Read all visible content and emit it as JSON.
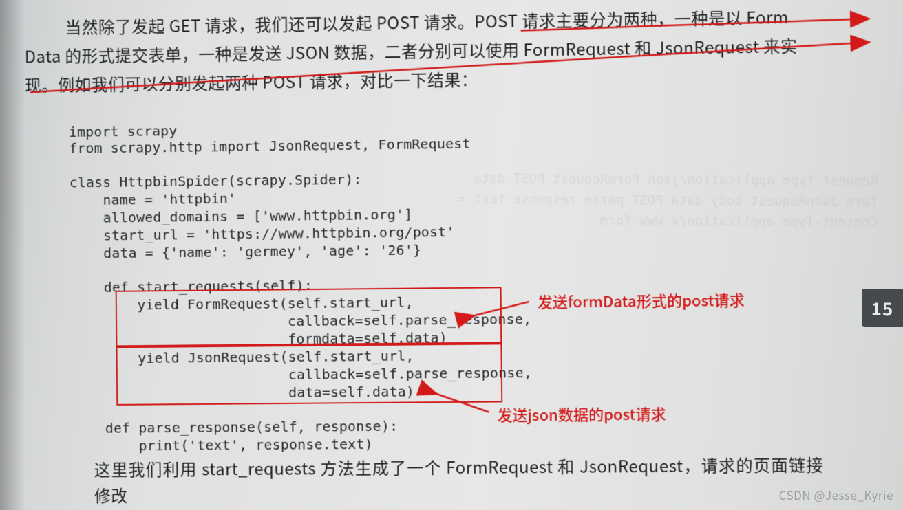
{
  "paragraphs": {
    "p1": "当然除了发起 GET 请求，我们还可以发起 POST 请求。POST 请求主要分为两种，一种是以 Form",
    "p2": "Data 的形式提交表单，一种是发送 JSON 数据，二者分别可以使用 FormRequest 和 JsonRequest 来实",
    "p3": "现。例如我们可以分别发起两种 POST 请求，对比一下结果：",
    "bottom": "这里我们利用 start_requests 方法生成了一个 FormRequest 和 JsonRequest，请求的页面链接修改"
  },
  "code": {
    "l1": "import scrapy",
    "l2": "from scrapy.http import JsonRequest, FormRequest",
    "l3": "",
    "l4": "class HttpbinSpider(scrapy.Spider):",
    "l5": "    name = 'httpbin'",
    "l6": "    allowed_domains = ['www.httpbin.org']",
    "l7": "    start_url = 'https://www.httpbin.org/post'",
    "l8": "    data = {'name': 'germey', 'age': '26'}",
    "l9": "",
    "l10": "    def start_requests(self):",
    "l11": "        yield FormRequest(self.start_url,",
    "l12": "                          callback=self.parse_response,",
    "l13": "                          formdata=self.data)",
    "l14": "        yield JsonRequest(self.start_url,",
    "l15": "                          callback=self.parse_response,",
    "l16": "                          data=self.data)",
    "l17": "",
    "l18": "    def parse_response(self, response):",
    "l19": "        print('text', response.text)"
  },
  "annotations": {
    "form_label": "发送formData形式的post请求",
    "json_label": "发送json数据的post请求"
  },
  "page_tab": "15",
  "watermark": "CSDN @Jesse_Kyrie"
}
